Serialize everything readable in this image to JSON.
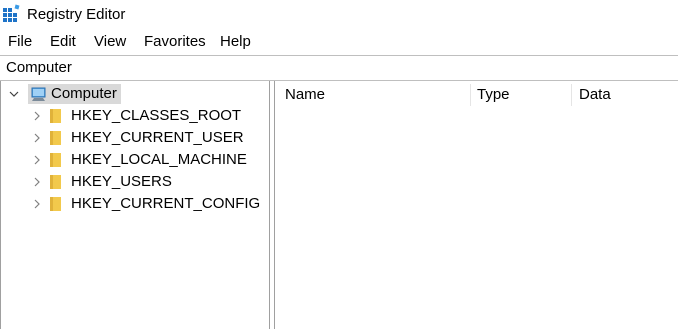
{
  "window": {
    "title": "Registry Editor",
    "title_icon": "registry-editor-icon"
  },
  "menu": {
    "items": [
      "File",
      "Edit",
      "View",
      "Favorites",
      "Help"
    ]
  },
  "address": {
    "path": "Computer"
  },
  "tree": {
    "root": {
      "label": "Computer",
      "icon": "computer-icon",
      "expanded": true,
      "selected": true
    },
    "children": [
      {
        "label": "HKEY_CLASSES_ROOT",
        "icon": "folder-icon",
        "expanded": false
      },
      {
        "label": "HKEY_CURRENT_USER",
        "icon": "folder-icon",
        "expanded": false
      },
      {
        "label": "HKEY_LOCAL_MACHINE",
        "icon": "folder-icon",
        "expanded": false
      },
      {
        "label": "HKEY_USERS",
        "icon": "folder-icon",
        "expanded": false
      },
      {
        "label": "HKEY_CURRENT_CONFIG",
        "icon": "folder-icon",
        "expanded": false
      }
    ]
  },
  "list": {
    "columns": [
      "Name",
      "Type",
      "Data"
    ]
  },
  "colors": {
    "selection": "#d9d9d9",
    "folder": "#f2c94c",
    "border": "#a0a0a0"
  }
}
